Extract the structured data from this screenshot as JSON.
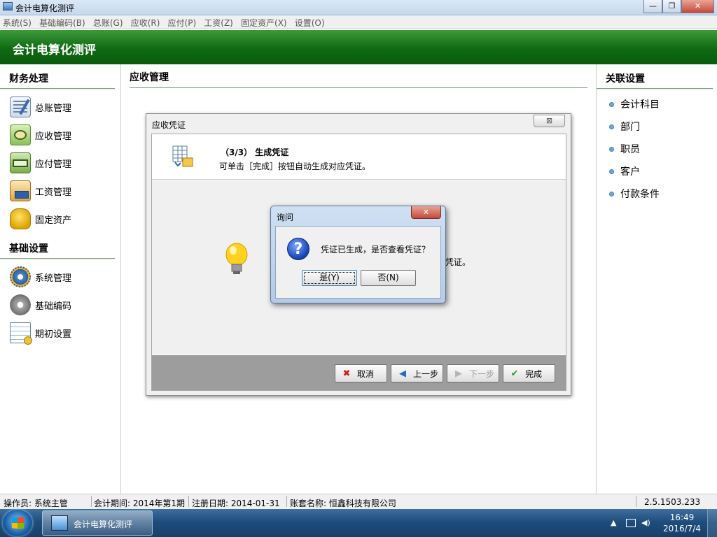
{
  "window": {
    "title": "会计电算化测评",
    "min": "—",
    "max": "❐",
    "close": "✕"
  },
  "menu": [
    "系统(S)",
    "基础编码(B)",
    "总账(G)",
    "应收(R)",
    "应付(P)",
    "工资(Z)",
    "固定资产(X)",
    "设置(O)"
  ],
  "banner": "会计电算化测评",
  "left": {
    "section1": "财务处理",
    "items1": [
      {
        "label": "总账管理",
        "icon": "ledger-icon"
      },
      {
        "label": "应收管理",
        "icon": "receivable-icon"
      },
      {
        "label": "应付管理",
        "icon": "payable-icon"
      },
      {
        "label": "工资管理",
        "icon": "payroll-icon"
      },
      {
        "label": "固定资产",
        "icon": "fixed-asset-icon"
      }
    ],
    "section2": "基础设置",
    "items2": [
      {
        "label": "系统管理",
        "icon": "gear-icon"
      },
      {
        "label": "基础编码",
        "icon": "gear-gray-icon"
      },
      {
        "label": "期初设置",
        "icon": "spreadsheet-icon"
      }
    ]
  },
  "center": {
    "heading": "应收管理"
  },
  "right": {
    "section": "关联设置",
    "links": [
      "会计科目",
      "部门",
      "职员",
      "客户",
      "付款条件"
    ]
  },
  "wizard": {
    "title": "应收凭证",
    "close": "⊠",
    "step": "（3/3） 生成凭证",
    "step_desc": "可单击［完成］按钮自动生成对应凭证。",
    "body_text_visible": "凭证。",
    "buttons": {
      "cancel": "取消",
      "prev": "上一步",
      "next": "下一步",
      "finish": "完成"
    }
  },
  "confirm": {
    "title": "询问",
    "close": "✕",
    "message": "凭证已生成，是否查看凭证？",
    "yes": "是(Y)",
    "no": "否(N)"
  },
  "status": {
    "operator": "操作员: 系统主管",
    "period": "会计期间: 2014年第1期",
    "reg_date": "注册日期: 2014-01-31",
    "company": "账套名称: 恒鑫科技有限公司",
    "version": "2.5.1503.233"
  },
  "taskbar": {
    "app_label": "会计电算化测评",
    "time": "16:49",
    "date": "2016/7/4"
  },
  "colors": {
    "banner": "#0f6a12",
    "accent": "#1a48b8"
  }
}
